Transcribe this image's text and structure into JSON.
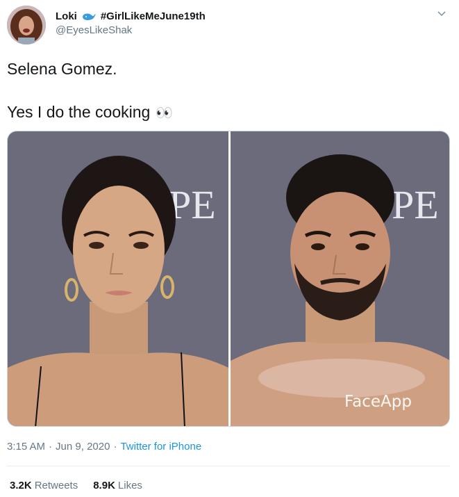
{
  "tweet": {
    "display_name": "Loki",
    "hashtag": "#GirlLikeMeJune19th",
    "handle": "@EyesLikeShak",
    "line1": "Selena Gomez.",
    "line2": "Yes I do the cooking",
    "emoji": "👀",
    "time": "3:15 AM",
    "date": "Jun 9, 2020",
    "separator": "·",
    "source": "Twitter for iPhone",
    "retweets_count": "3.2K",
    "retweets_label": "Retweets",
    "likes_count": "8.9K",
    "likes_label": "Likes"
  },
  "media": {
    "backdrop_text": "PEI",
    "watermark": "FaceApp",
    "backdrop_color": "#6b6b7b"
  },
  "icons": {
    "verified_badge": "whale-icon",
    "menu": "chevron-down-icon"
  }
}
